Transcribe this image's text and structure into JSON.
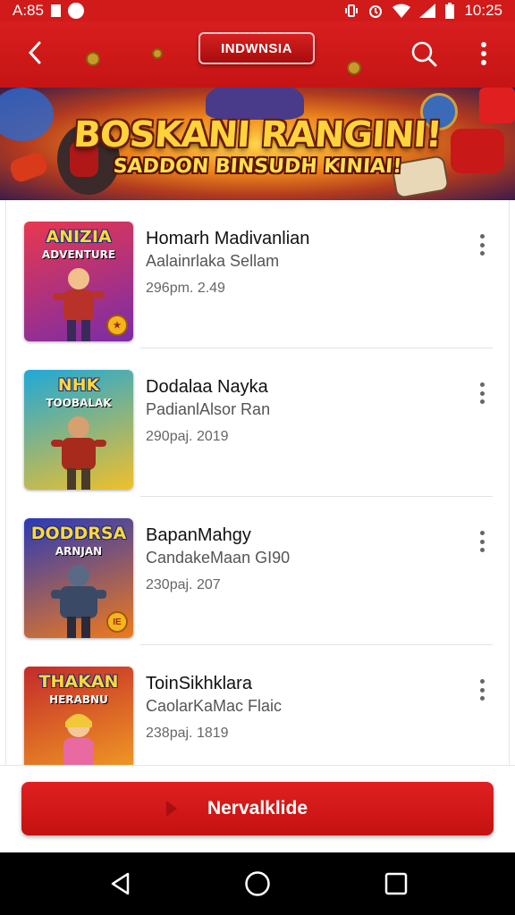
{
  "status_bar": {
    "time_left": "A:85",
    "time_right": "10:25"
  },
  "app_bar": {
    "title": "INDWNSIA"
  },
  "banner": {
    "headline": "BOSKANI RANGINI!",
    "subheadline": "SADDON BINSUDH KINIAI!"
  },
  "games": [
    {
      "name": "Homarh Madivanlian",
      "subtitle": "Aalainrlaka Sellam",
      "meta": "296pm. 2.49",
      "thumb_title": "ANIZIA",
      "thumb_sub": "ADVENTURE",
      "badge": "★",
      "colors": {
        "bg1": "#e8384f",
        "bg2": "#7a2ca8",
        "hero": "#b8322a"
      }
    },
    {
      "name": "Dodalaa Nayka",
      "subtitle": "PadianlAlsor Ran",
      "meta": "290paj. 2019",
      "thumb_title": "NHK",
      "thumb_sub": "TOOBALAK",
      "badge": "",
      "colors": {
        "bg1": "#1fa8d8",
        "bg2": "#f0c02a",
        "hero": "#a82a1c"
      }
    },
    {
      "name": "BapanMahgy",
      "subtitle": "CandakeMaan GI90",
      "meta": "230paj. 207",
      "thumb_title": "DODDRSA",
      "thumb_sub": "ARNJAN",
      "badge": "IE",
      "colors": {
        "bg1": "#2a3ab8",
        "bg2": "#f07a1a",
        "hero": "#3a4a66"
      }
    },
    {
      "name": "ToinSikhklara",
      "subtitle": "CaolarKaMac Flaic",
      "meta": "238paj. 1819",
      "thumb_title": "THAKAN",
      "thumb_sub": "HERABNU",
      "badge": "",
      "colors": {
        "bg1": "#c42a2a",
        "bg2": "#f5a623",
        "hero": "#e86aa0"
      }
    }
  ],
  "cta": {
    "label": "Nervalklide"
  }
}
